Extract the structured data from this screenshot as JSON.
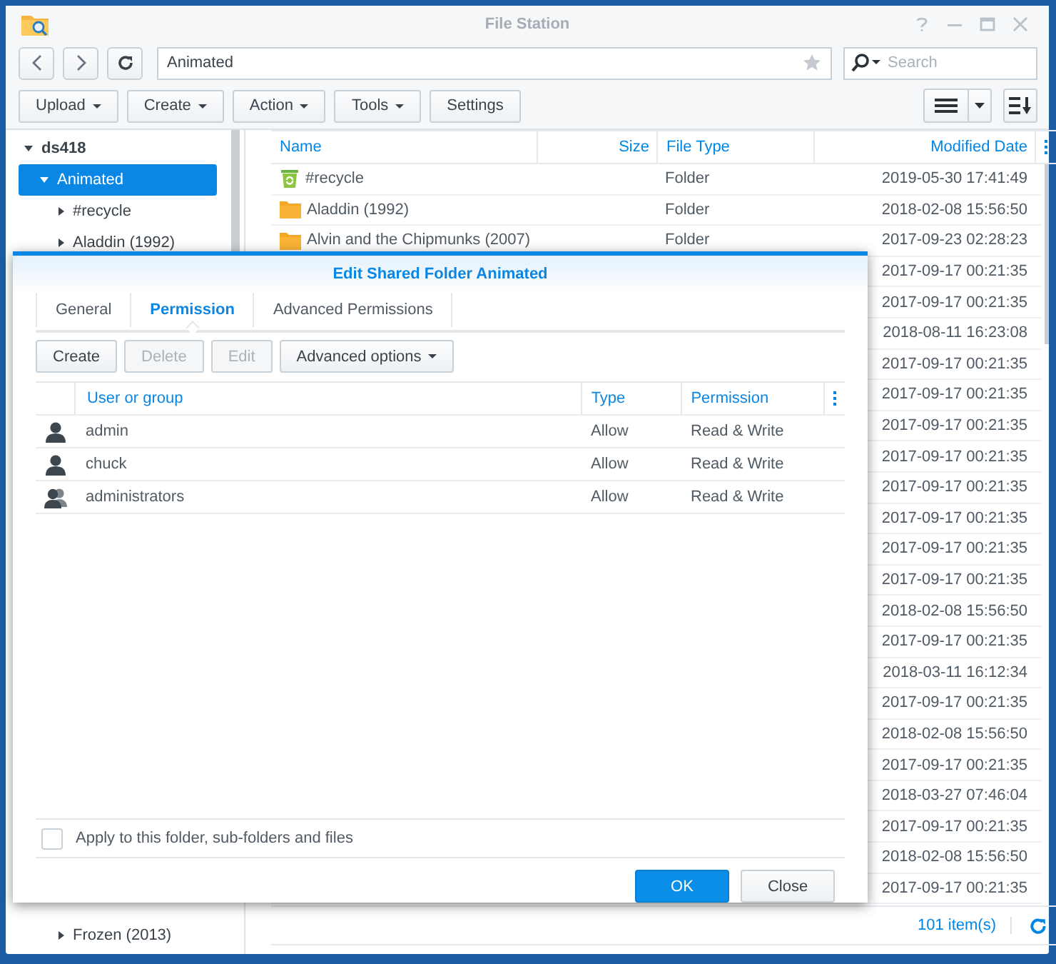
{
  "window": {
    "title": "File Station"
  },
  "nav": {
    "path": "Animated",
    "search_placeholder": "Search"
  },
  "toolbar": [
    {
      "label": "Upload",
      "dropdown": true
    },
    {
      "label": "Create",
      "dropdown": true
    },
    {
      "label": "Action",
      "dropdown": true
    },
    {
      "label": "Tools",
      "dropdown": true
    },
    {
      "label": "Settings",
      "dropdown": false
    }
  ],
  "sidebar": {
    "items": [
      {
        "label": "ds418",
        "selected": false,
        "expanded": true,
        "children": [
          {
            "label": "Animated",
            "selected": true,
            "expanded": true,
            "children": [
              {
                "label": "#recycle",
                "selected": false,
                "expanded": false
              },
              {
                "label": "Aladdin (1992)",
                "selected": false,
                "expanded": false
              },
              {
                "label": "Frozen (2013)",
                "selected": false,
                "expanded": false
              }
            ]
          }
        ]
      }
    ]
  },
  "file_list": {
    "columns": [
      "Name",
      "Size",
      "File Type",
      "Modified Date"
    ],
    "rows": [
      {
        "kind": "recycle",
        "name": "#recycle",
        "type": "Folder",
        "modified": "2019-05-30 17:41:49"
      },
      {
        "kind": "folder",
        "name": "Aladdin (1992)",
        "type": "Folder",
        "modified": "2018-02-08 15:56:50"
      },
      {
        "kind": "folder",
        "name": "Alvin and the Chipmunks (2007)",
        "type": "Folder",
        "modified": "2017-09-23 02:28:23"
      },
      {
        "modified": "2017-09-17 00:21:35"
      },
      {
        "modified": "2017-09-17 00:21:35"
      },
      {
        "modified": "2018-08-11 16:23:08"
      },
      {
        "modified": "2017-09-17 00:21:35"
      },
      {
        "modified": "2017-09-17 00:21:35"
      },
      {
        "modified": "2017-09-17 00:21:35"
      },
      {
        "modified": "2017-09-17 00:21:35"
      },
      {
        "modified": "2017-09-17 00:21:35"
      },
      {
        "modified": "2017-09-17 00:21:35"
      },
      {
        "modified": "2017-09-17 00:21:35"
      },
      {
        "modified": "2017-09-17 00:21:35"
      },
      {
        "modified": "2018-02-08 15:56:50"
      },
      {
        "modified": "2017-09-17 00:21:35"
      },
      {
        "modified": "2018-03-11 16:12:34"
      },
      {
        "modified": "2017-09-17 00:21:35"
      },
      {
        "modified": "2018-02-08 15:56:50"
      },
      {
        "modified": "2017-09-17 00:21:35"
      },
      {
        "modified": "2018-03-27 07:46:04"
      },
      {
        "modified": "2017-09-17 00:21:35"
      },
      {
        "modified": "2018-02-08 15:56:50"
      },
      {
        "modified": "2017-09-17 00:21:35"
      }
    ],
    "count": "101 item(s)"
  },
  "dialog": {
    "title": "Edit Shared Folder Animated",
    "tabs": [
      {
        "label": "General",
        "selected": false
      },
      {
        "label": "Permission",
        "selected": true
      },
      {
        "label": "Advanced Permissions",
        "selected": false
      }
    ],
    "buttons": [
      {
        "label": "Create",
        "disabled": false,
        "dropdown": false
      },
      {
        "label": "Delete",
        "disabled": true,
        "dropdown": false
      },
      {
        "label": "Edit",
        "disabled": true,
        "dropdown": false
      },
      {
        "label": "Advanced options",
        "disabled": false,
        "dropdown": true
      }
    ],
    "columns": [
      "User or group",
      "Type",
      "Permission"
    ],
    "rows": [
      {
        "kind": "user",
        "name": "admin",
        "type": "Allow",
        "permission": "Read & Write"
      },
      {
        "kind": "user",
        "name": "chuck",
        "type": "Allow",
        "permission": "Read & Write"
      },
      {
        "kind": "group",
        "name": "administrators",
        "type": "Allow",
        "permission": "Read & Write"
      }
    ],
    "apply": {
      "label": "Apply to this folder, sub-folders and files",
      "checked": false
    },
    "actions": [
      {
        "label": "OK",
        "kind": "primary"
      },
      {
        "label": "Close",
        "kind": "secondary"
      }
    ]
  }
}
